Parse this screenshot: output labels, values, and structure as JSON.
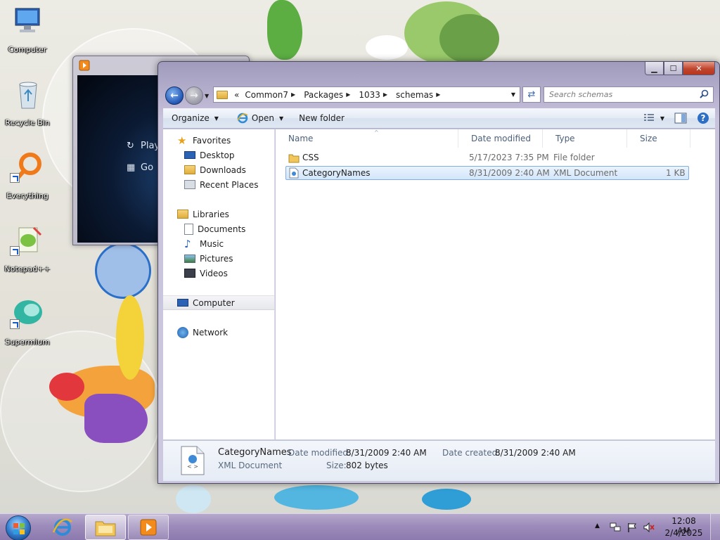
{
  "desktop": {
    "icons": [
      {
        "label": "Computer",
        "icon": "computer-icon"
      },
      {
        "label": "Recycle Bin",
        "icon": "recycle-bin-icon"
      },
      {
        "label": "Everything",
        "icon": "everything-icon"
      },
      {
        "label": "Notepad++",
        "icon": "notepad-plus-plus-icon"
      },
      {
        "label": "Supermium",
        "icon": "supermium-icon"
      }
    ]
  },
  "media_window": {
    "items": [
      {
        "label": "Play",
        "icon": "refresh-circle-icon"
      },
      {
        "label": "Go",
        "icon": "grid-icon"
      }
    ]
  },
  "explorer": {
    "address": {
      "overflow": "«",
      "crumbs": [
        "Common7",
        "Packages",
        "1033",
        "schemas"
      ]
    },
    "search": {
      "placeholder": "Search schemas"
    },
    "commands": {
      "organize": "Organize",
      "open": "Open",
      "new_folder": "New folder"
    },
    "nav": {
      "favorites": {
        "label": "Favorites",
        "items": [
          "Desktop",
          "Downloads",
          "Recent Places"
        ]
      },
      "libraries": {
        "label": "Libraries",
        "items": [
          "Documents",
          "Music",
          "Pictures",
          "Videos"
        ]
      },
      "computer": "Computer",
      "network": "Network",
      "selected": "Computer"
    },
    "columns": {
      "name": "Name",
      "date": "Date modified",
      "type": "Type",
      "size": "Size"
    },
    "files": [
      {
        "name": "CSS",
        "date": "5/17/2023 7:35 PM",
        "type": "File folder",
        "size": "",
        "icon": "folder-icon",
        "selected": false
      },
      {
        "name": "CategoryNames",
        "date": "8/31/2009 2:40 AM",
        "type": "XML Document",
        "size": "1 KB",
        "icon": "xml-document-icon",
        "selected": true
      }
    ],
    "details": {
      "name": "CategoryNames",
      "type": "XML Document",
      "date_modified_label": "Date modified:",
      "date_modified": "8/31/2009 2:40 AM",
      "date_created_label": "Date created:",
      "date_created": "8/31/2009 2:40 AM",
      "size_label": "Size:",
      "size": "802 bytes"
    }
  },
  "taskbar": {
    "pinned": [
      "internet-explorer-icon",
      "file-explorer-icon",
      "media-player-icon"
    ],
    "tray": {
      "time": "12:08 AM",
      "date": "2/4/2025"
    }
  },
  "colors": {
    "selection_border": "#84acdd",
    "selection_fill": "#d3e6fb",
    "close_button": "#c0452d"
  }
}
